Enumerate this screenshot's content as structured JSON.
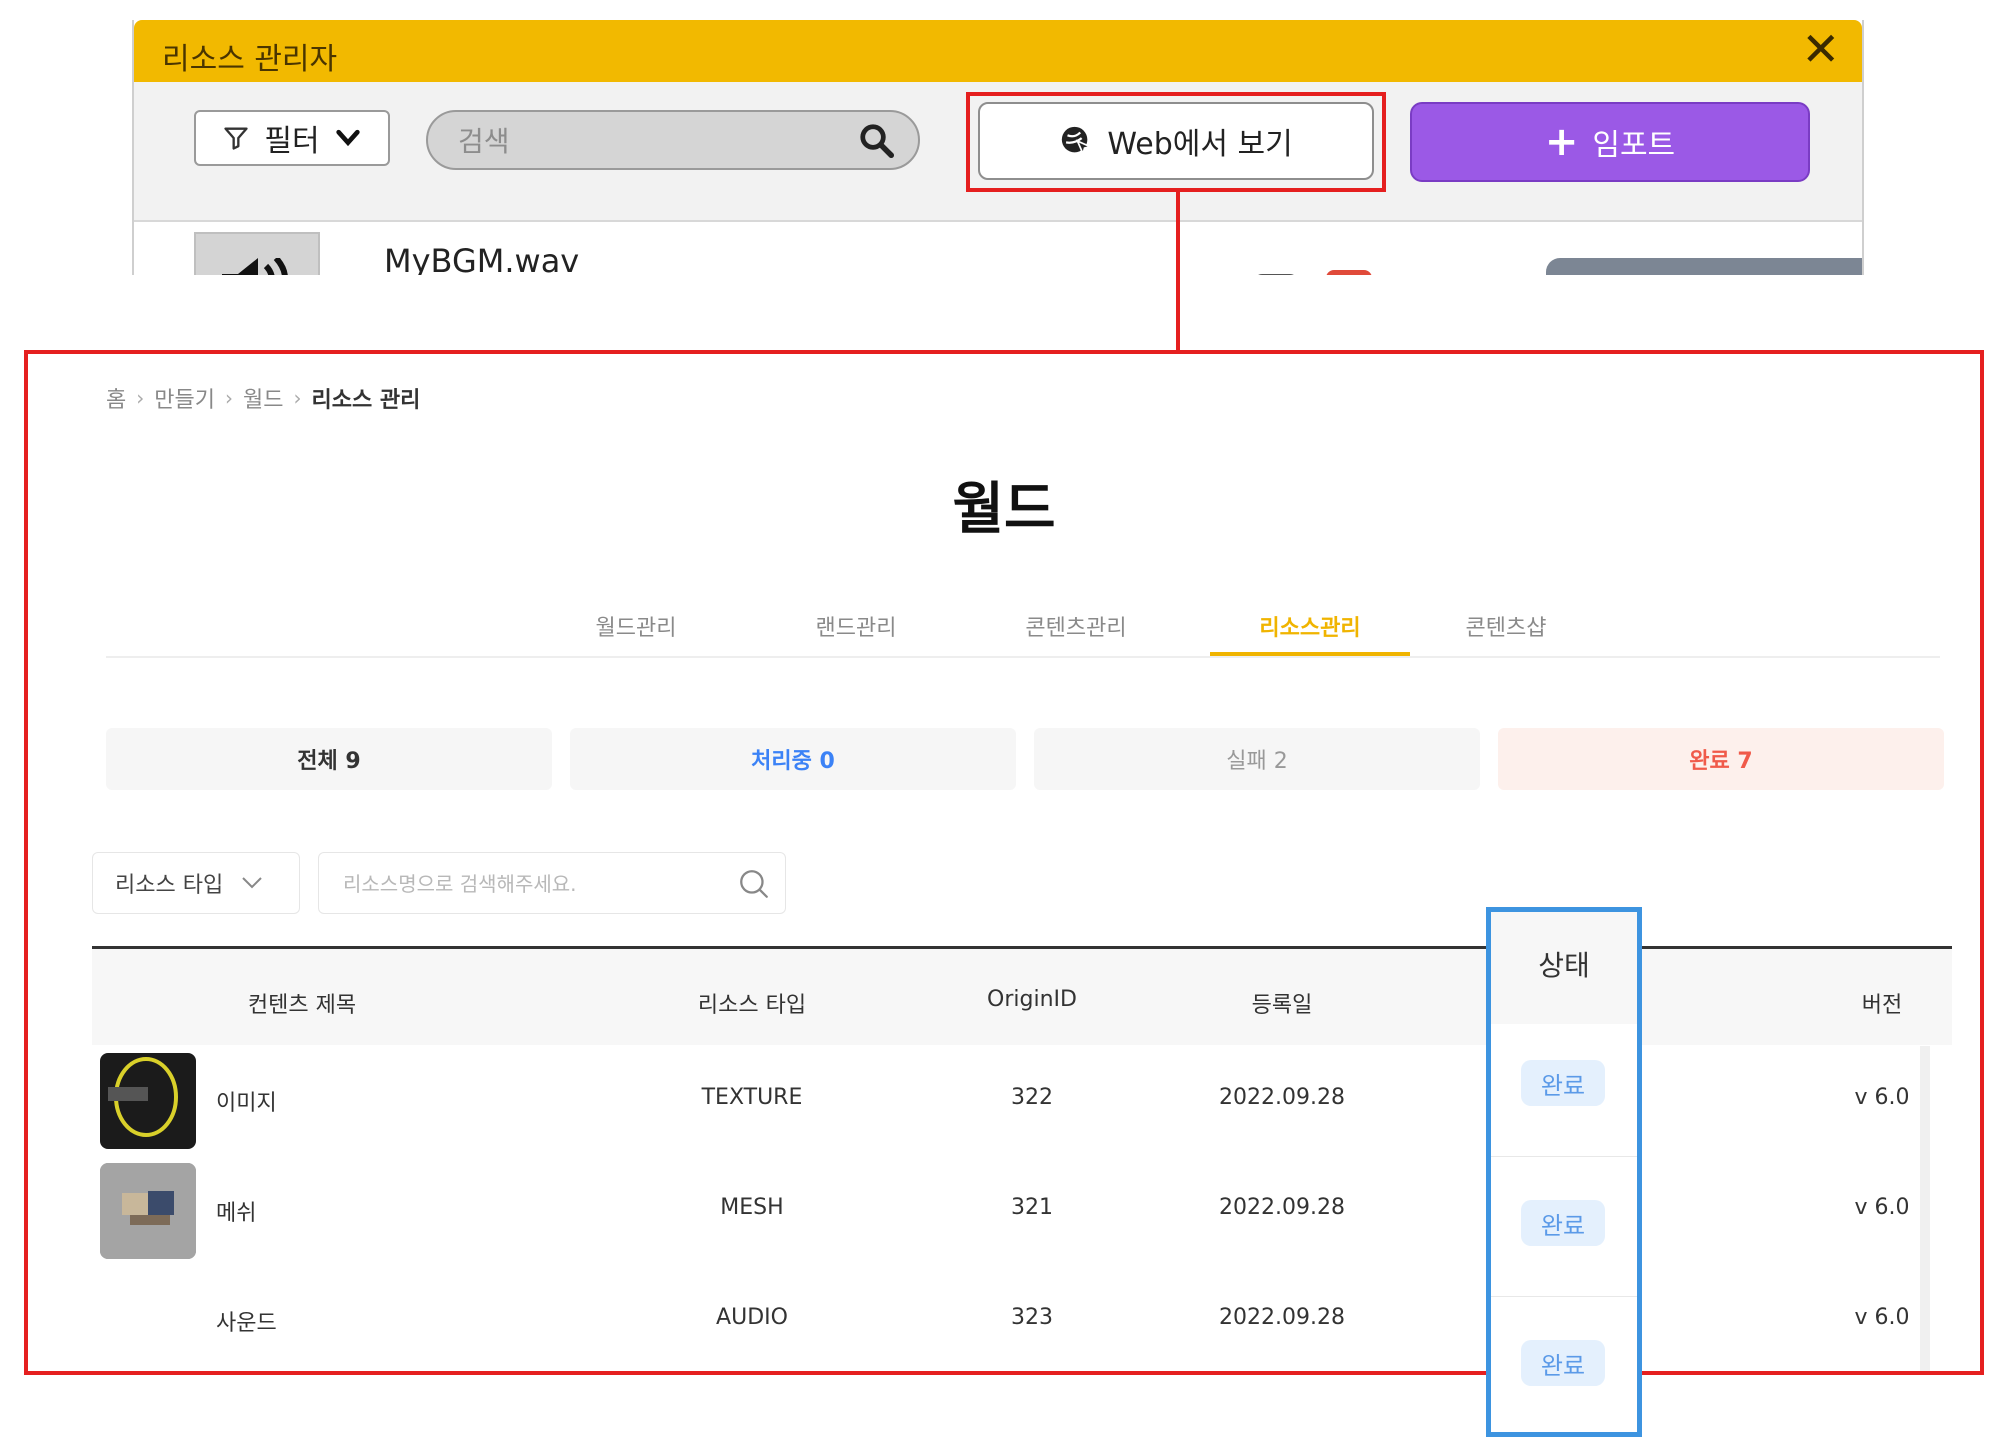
{
  "resource_manager": {
    "title": "리소스 관리자",
    "close_icon": "close-icon",
    "filter_label": "필터",
    "search_placeholder": "검색",
    "web_view_label": "Web에서 보기",
    "import_label": "임포트",
    "files": [
      {
        "name": "MyBGM.wav",
        "icon": "speaker-icon"
      }
    ]
  },
  "web": {
    "breadcrumb": [
      "홈",
      "만들기",
      "월드",
      "리소스 관리"
    ],
    "title": "월드",
    "tabs": [
      {
        "label": "월드관리",
        "active": false
      },
      {
        "label": "랜드관리",
        "active": false
      },
      {
        "label": "콘텐츠관리",
        "active": false
      },
      {
        "label": "리소스관리",
        "active": true
      },
      {
        "label": "콘텐츠샵",
        "active": false
      }
    ],
    "status_cards": [
      {
        "label": "전체 9",
        "color": "#333333",
        "bg": "#f6f6f6"
      },
      {
        "label": "처리중 0",
        "color": "#3b82f6",
        "bg": "#f6f6f6"
      },
      {
        "label": "실패 2",
        "color": "#999999",
        "bg": "#f6f6f6"
      },
      {
        "label": "완료 7",
        "color": "#f05a4a",
        "bg": "#fdf0ec"
      }
    ],
    "type_select": "리소스 타입",
    "search_placeholder": "리소스명으로 검색해주세요.",
    "table": {
      "columns": [
        "컨텐츠 제목",
        "리소스 타입",
        "OriginID",
        "등록일",
        "상태",
        "버전"
      ],
      "rows": [
        {
          "title": "이미지",
          "type": "TEXTURE",
          "origin_id": "322",
          "date": "2022.09.28",
          "status": "완료",
          "version": "v 6.0"
        },
        {
          "title": "메쉬",
          "type": "MESH",
          "origin_id": "321",
          "date": "2022.09.28",
          "status": "완료",
          "version": "v 6.0"
        },
        {
          "title": "사운드",
          "type": "AUDIO",
          "origin_id": "323",
          "date": "2022.09.28",
          "status": "완료",
          "version": "v 6.0"
        }
      ]
    }
  },
  "colors": {
    "titlebar": "#f2b900",
    "import": "#9b59e6",
    "highlight_red": "#e51f1f",
    "highlight_blue": "#3d94e0",
    "active_tab": "#f0b400",
    "badge_bg": "#e4f0fd",
    "badge_text": "#5b9ae8"
  }
}
